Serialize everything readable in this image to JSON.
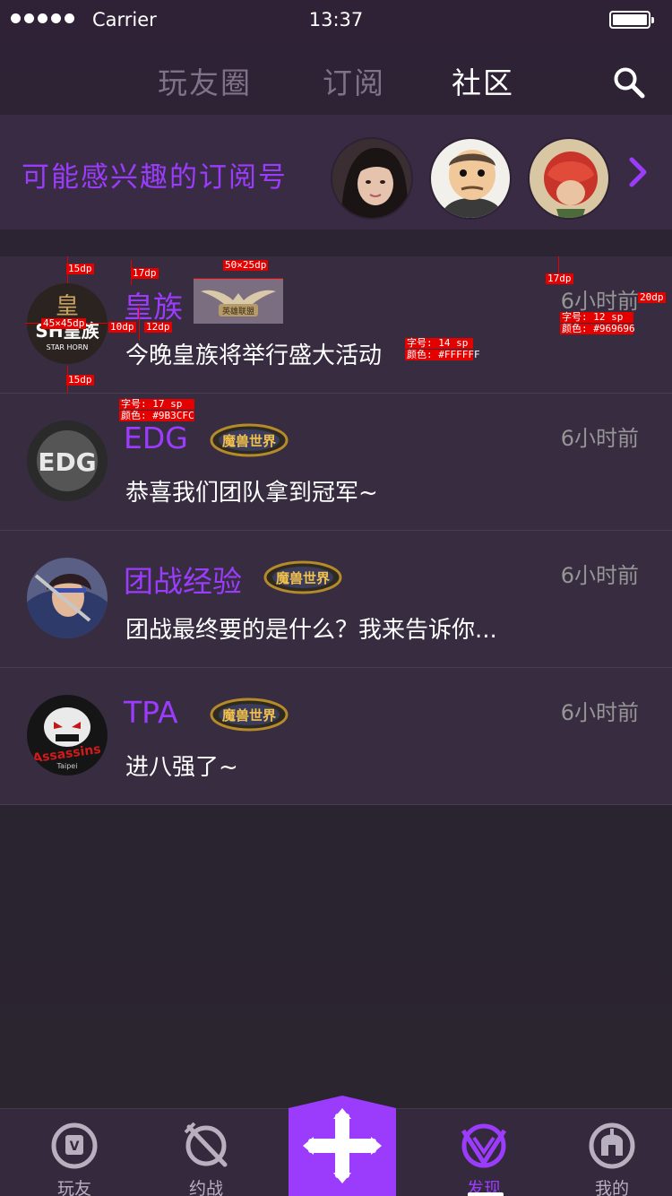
{
  "status_bar": {
    "carrier": "Carrier",
    "time": "13:37"
  },
  "tabs": [
    {
      "label": "玩友圈",
      "active": false
    },
    {
      "label": "订阅",
      "active": false
    },
    {
      "label": "社区",
      "active": true
    }
  ],
  "suggest": {
    "title": "可能感兴趣的订阅号"
  },
  "posts": [
    {
      "name": "皇族",
      "text": "今晚皇族将举行盛大活动",
      "time": "6小时前",
      "badge": "英雄联盟"
    },
    {
      "name": "EDG",
      "text": "恭喜我们团队拿到冠军~",
      "time": "6小时前",
      "badge": "魔兽世界"
    },
    {
      "name": "团战经验",
      "text": "团战最终要的是什么？我来告诉你...",
      "time": "6小时前",
      "badge": "魔兽世界"
    },
    {
      "name": "TPA",
      "text": "进八强了~",
      "time": "6小时前",
      "badge": "魔兽世界"
    }
  ],
  "annotations": {
    "a1": "15dp",
    "a2": "17dp",
    "a3": "50×25dp",
    "a4": "17dp",
    "a5": "20dp",
    "a6": "45×45dp",
    "a7": "10dp",
    "a8": "12dp",
    "a9": "15dp",
    "a10a": "字号: 12 sp",
    "a10b": "颜色: #969696",
    "a11a": "字号: 14 sp",
    "a11b": "颜色: #FFFFFF",
    "a12a": "字号: 17 sp",
    "a12b": "颜色: #9B3CFC"
  },
  "avatar_labels": {
    "a1_top": "皇",
    "a1_main": "SH皇族",
    "a1_sub": "STAR HORN",
    "a2": "EDG",
    "a4_main": "Assassins",
    "a4_sub": "Taipei"
  },
  "bottom_nav": [
    {
      "label": "玩友",
      "icon": "vs-shield-icon"
    },
    {
      "label": "约战",
      "icon": "crossed-swords-icon"
    },
    {
      "label": "发现",
      "icon": "discover-v-icon",
      "active": true
    },
    {
      "label": "我的",
      "icon": "spartan-helmet-icon"
    }
  ],
  "colors": {
    "accent": "#9B3CFC",
    "time": "#969696",
    "text": "#FFFFFF"
  }
}
